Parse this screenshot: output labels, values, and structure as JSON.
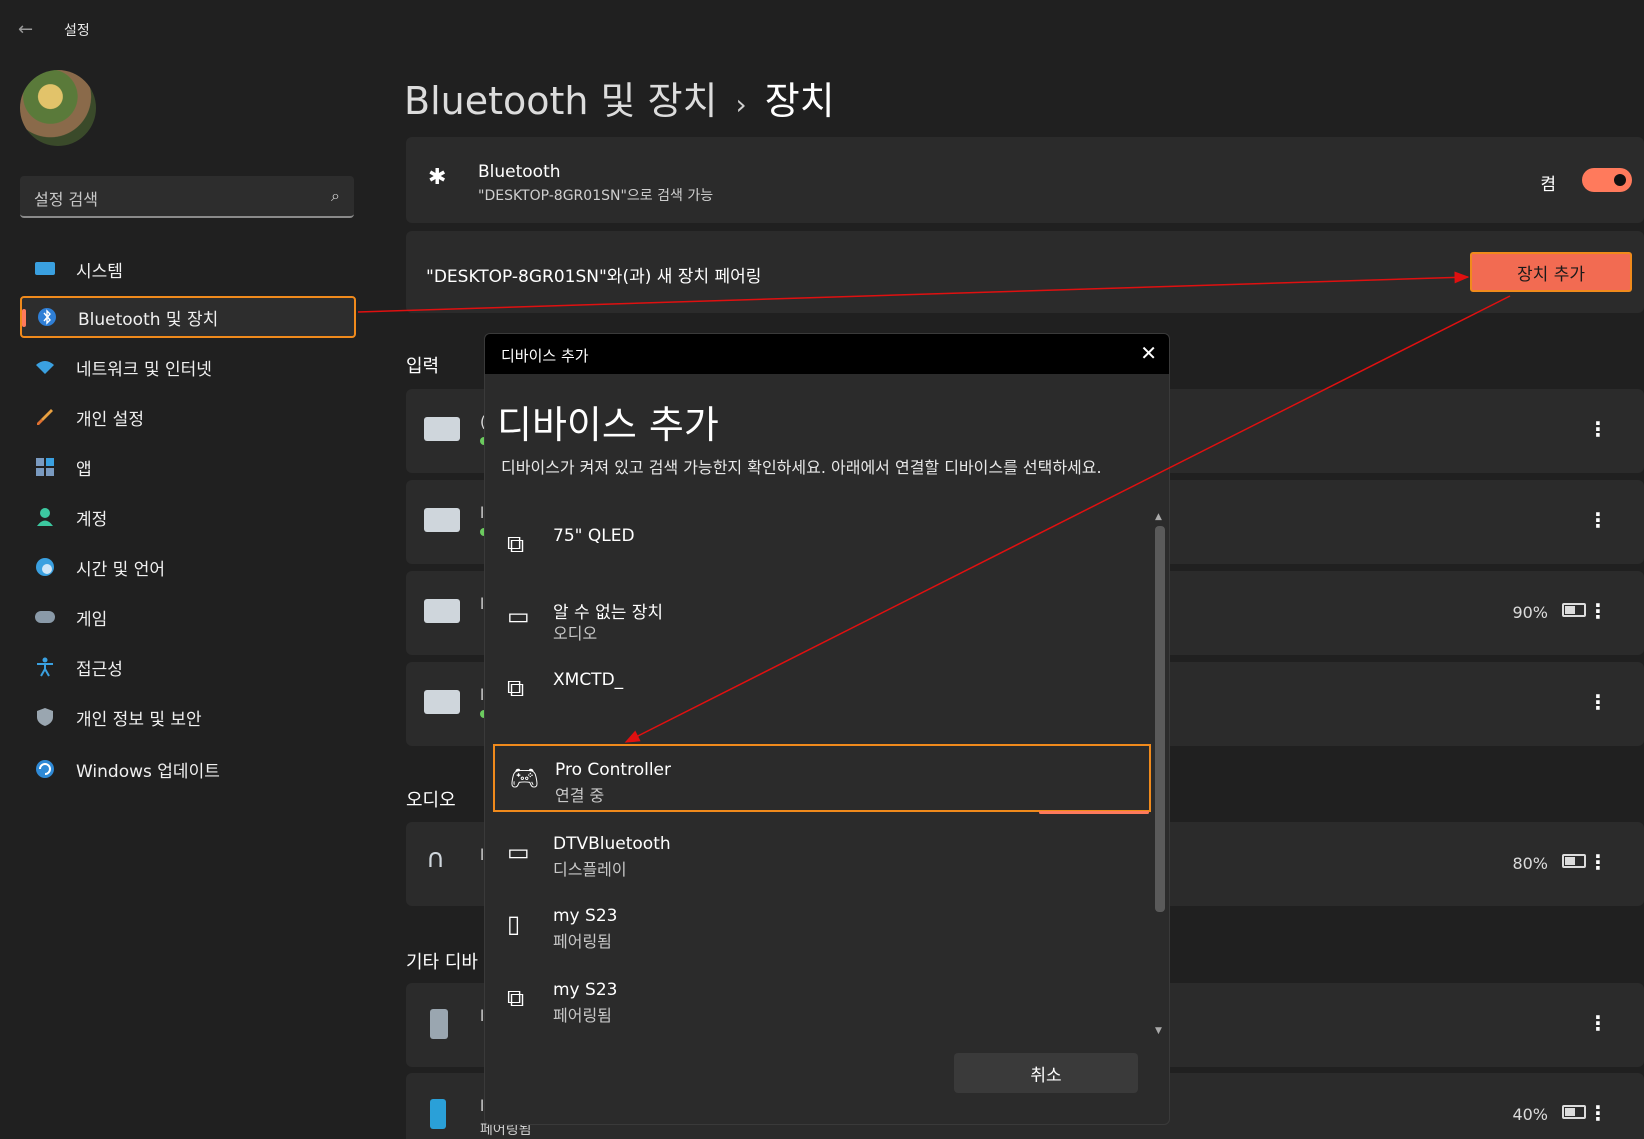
{
  "app": {
    "title": "설정",
    "back_icon": "back-arrow-icon"
  },
  "search": {
    "placeholder": "설정 검색",
    "icon": "search-icon"
  },
  "sidebar": {
    "items": [
      {
        "label": "시스템",
        "icon": "system-icon"
      },
      {
        "label": "Bluetooth 및 장치",
        "icon": "bluetooth-icon",
        "active": true
      },
      {
        "label": "네트워크 및 인터넷",
        "icon": "wifi-icon"
      },
      {
        "label": "개인 설정",
        "icon": "brush-icon"
      },
      {
        "label": "앱",
        "icon": "apps-icon"
      },
      {
        "label": "계정",
        "icon": "account-icon"
      },
      {
        "label": "시간 및 언어",
        "icon": "clock-globe-icon"
      },
      {
        "label": "게임",
        "icon": "gamepad-icon"
      },
      {
        "label": "접근성",
        "icon": "accessibility-icon"
      },
      {
        "label": "개인 정보 및 보안",
        "icon": "shield-icon"
      },
      {
        "label": "Windows 업데이트",
        "icon": "update-icon"
      }
    ]
  },
  "header": {
    "parent": "Bluetooth 및 장치",
    "separator": "›",
    "current": "장치"
  },
  "bluetooth_card": {
    "title": "Bluetooth",
    "subtitle": "\"DESKTOP-8GR01SN\"으로 검색 가능",
    "toggle_label": "켬",
    "toggle_on": true
  },
  "pair_card": {
    "text": "\"DESKTOP-8GR01SN\"와(과) 새 장치 페어링",
    "button": "장치 추가"
  },
  "sections": {
    "input": "입력",
    "audio": "오디오",
    "other": "기타 디바"
  },
  "input_rows": [
    {
      "peek": "(",
      "battery": null,
      "connected": true
    },
    {
      "peek": "l",
      "battery": null,
      "connected": true
    },
    {
      "peek": "l",
      "battery": "90%",
      "connected": false
    },
    {
      "peek": "l",
      "battery": null,
      "connected": true
    }
  ],
  "audio_rows": [
    {
      "peek": "l",
      "battery": "80%"
    }
  ],
  "other_rows": [
    {
      "peek": "l",
      "battery": null
    },
    {
      "peek": "l",
      "battery": "40%",
      "sub": "페어링됨"
    }
  ],
  "dialog": {
    "bar_title": "디바이스 추가",
    "heading": "디바이스 추가",
    "description": "디바이스가 켜져 있고 검색 가능한지 확인하세요. 아래에서 연결할 디바이스를 선택하세요.",
    "devices": [
      {
        "name": "75\" QLED",
        "sub": "",
        "icon": "display-device-icon"
      },
      {
        "name": "알 수 없는 장치",
        "sub": "오디오",
        "icon": "monitor-icon"
      },
      {
        "name": "XMCTD_",
        "sub": "",
        "icon": "display-device-icon"
      },
      {
        "name": "Pro Controller",
        "sub": "연결 중",
        "icon": "gamepad-icon",
        "highlighted": true
      },
      {
        "name": "DTVBluetooth",
        "sub": "디스플레이",
        "icon": "monitor-icon"
      },
      {
        "name": "my S23",
        "sub": "페어링됨",
        "icon": "phone-icon"
      },
      {
        "name": "my S23",
        "sub": "페어링됨",
        "icon": "display-device-icon"
      }
    ],
    "cancel": "취소",
    "close_icon": "close-icon"
  },
  "accent": "#ff7a5c",
  "highlight": "#f08a1c"
}
